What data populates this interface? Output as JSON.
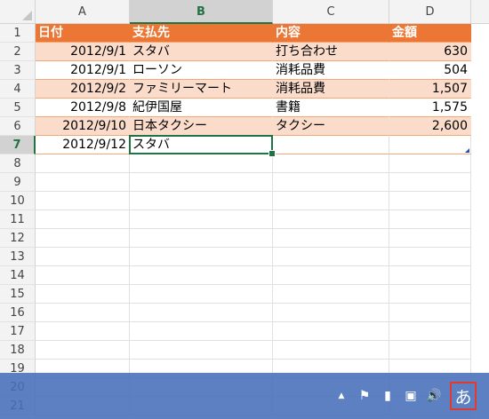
{
  "columns": [
    "A",
    "B",
    "C",
    "D"
  ],
  "row_numbers": [
    "1",
    "2",
    "3",
    "4",
    "5",
    "6",
    "7",
    "8",
    "9",
    "10",
    "11",
    "12",
    "13",
    "14",
    "15",
    "16",
    "17",
    "18",
    "19",
    "20",
    "21"
  ],
  "header_row": {
    "A": "日付",
    "B": "支払先",
    "C": "内容",
    "D": "金額"
  },
  "rows": [
    {
      "A": "2012/9/1",
      "B": "スタバ",
      "C": "打ち合わせ",
      "D": "630"
    },
    {
      "A": "2012/9/1",
      "B": "ローソン",
      "C": "消耗品費",
      "D": "504"
    },
    {
      "A": "2012/9/2",
      "B": "ファミリーマート",
      "C": "消耗品費",
      "D": "1,507"
    },
    {
      "A": "2012/9/8",
      "B": "紀伊国屋",
      "C": "書籍",
      "D": "1,575"
    },
    {
      "A": "2012/9/10",
      "B": "日本タクシー",
      "C": "タクシー",
      "D": "2,600"
    },
    {
      "A": "2012/9/12",
      "B": "スタバ",
      "C": "",
      "D": ""
    }
  ],
  "active_cell": "B7",
  "colors": {
    "table_header": "#ec7633",
    "band_row": "#fbdccb",
    "band_border": "#f4a774",
    "selection": "#217346",
    "taskbar": "#466eb9",
    "ime_highlight": "#e23b2e"
  },
  "taskbar": {
    "tray_icons": [
      "show-hidden-icons-icon",
      "action-center-flag-icon",
      "power-icon",
      "network-icon",
      "volume-icon"
    ],
    "tray_glyphs": [
      "▲",
      "⚑",
      "▮",
      "▣",
      "🔊"
    ],
    "ime_label": "あ"
  }
}
